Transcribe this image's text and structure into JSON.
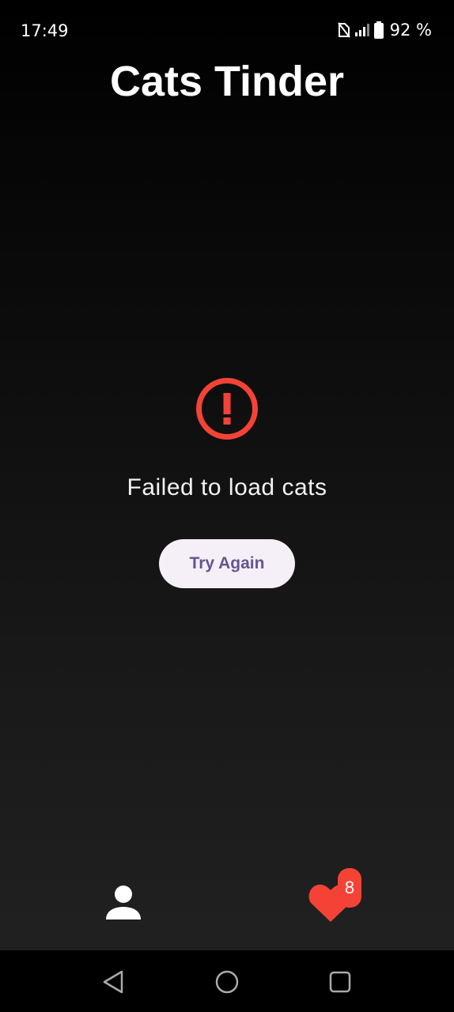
{
  "status_bar": {
    "time": "17:49",
    "battery": "92 %",
    "icons": [
      "nfc-icon",
      "signal-icon",
      "battery-icon"
    ]
  },
  "app": {
    "title": "Cats Tinder"
  },
  "error": {
    "icon": "error-circle-icon",
    "message": "Failed to load cats",
    "retry_label": "Try Again"
  },
  "bottom_nav": {
    "profile_icon": "person-icon",
    "favorites_icon": "heart-icon",
    "favorites_count": "8"
  },
  "system_nav": {
    "buttons": [
      "back-icon",
      "home-icon",
      "recents-icon"
    ]
  },
  "colors": {
    "error_red": "#f44336",
    "button_bg": "#f5eff7",
    "button_text": "#65558f"
  }
}
